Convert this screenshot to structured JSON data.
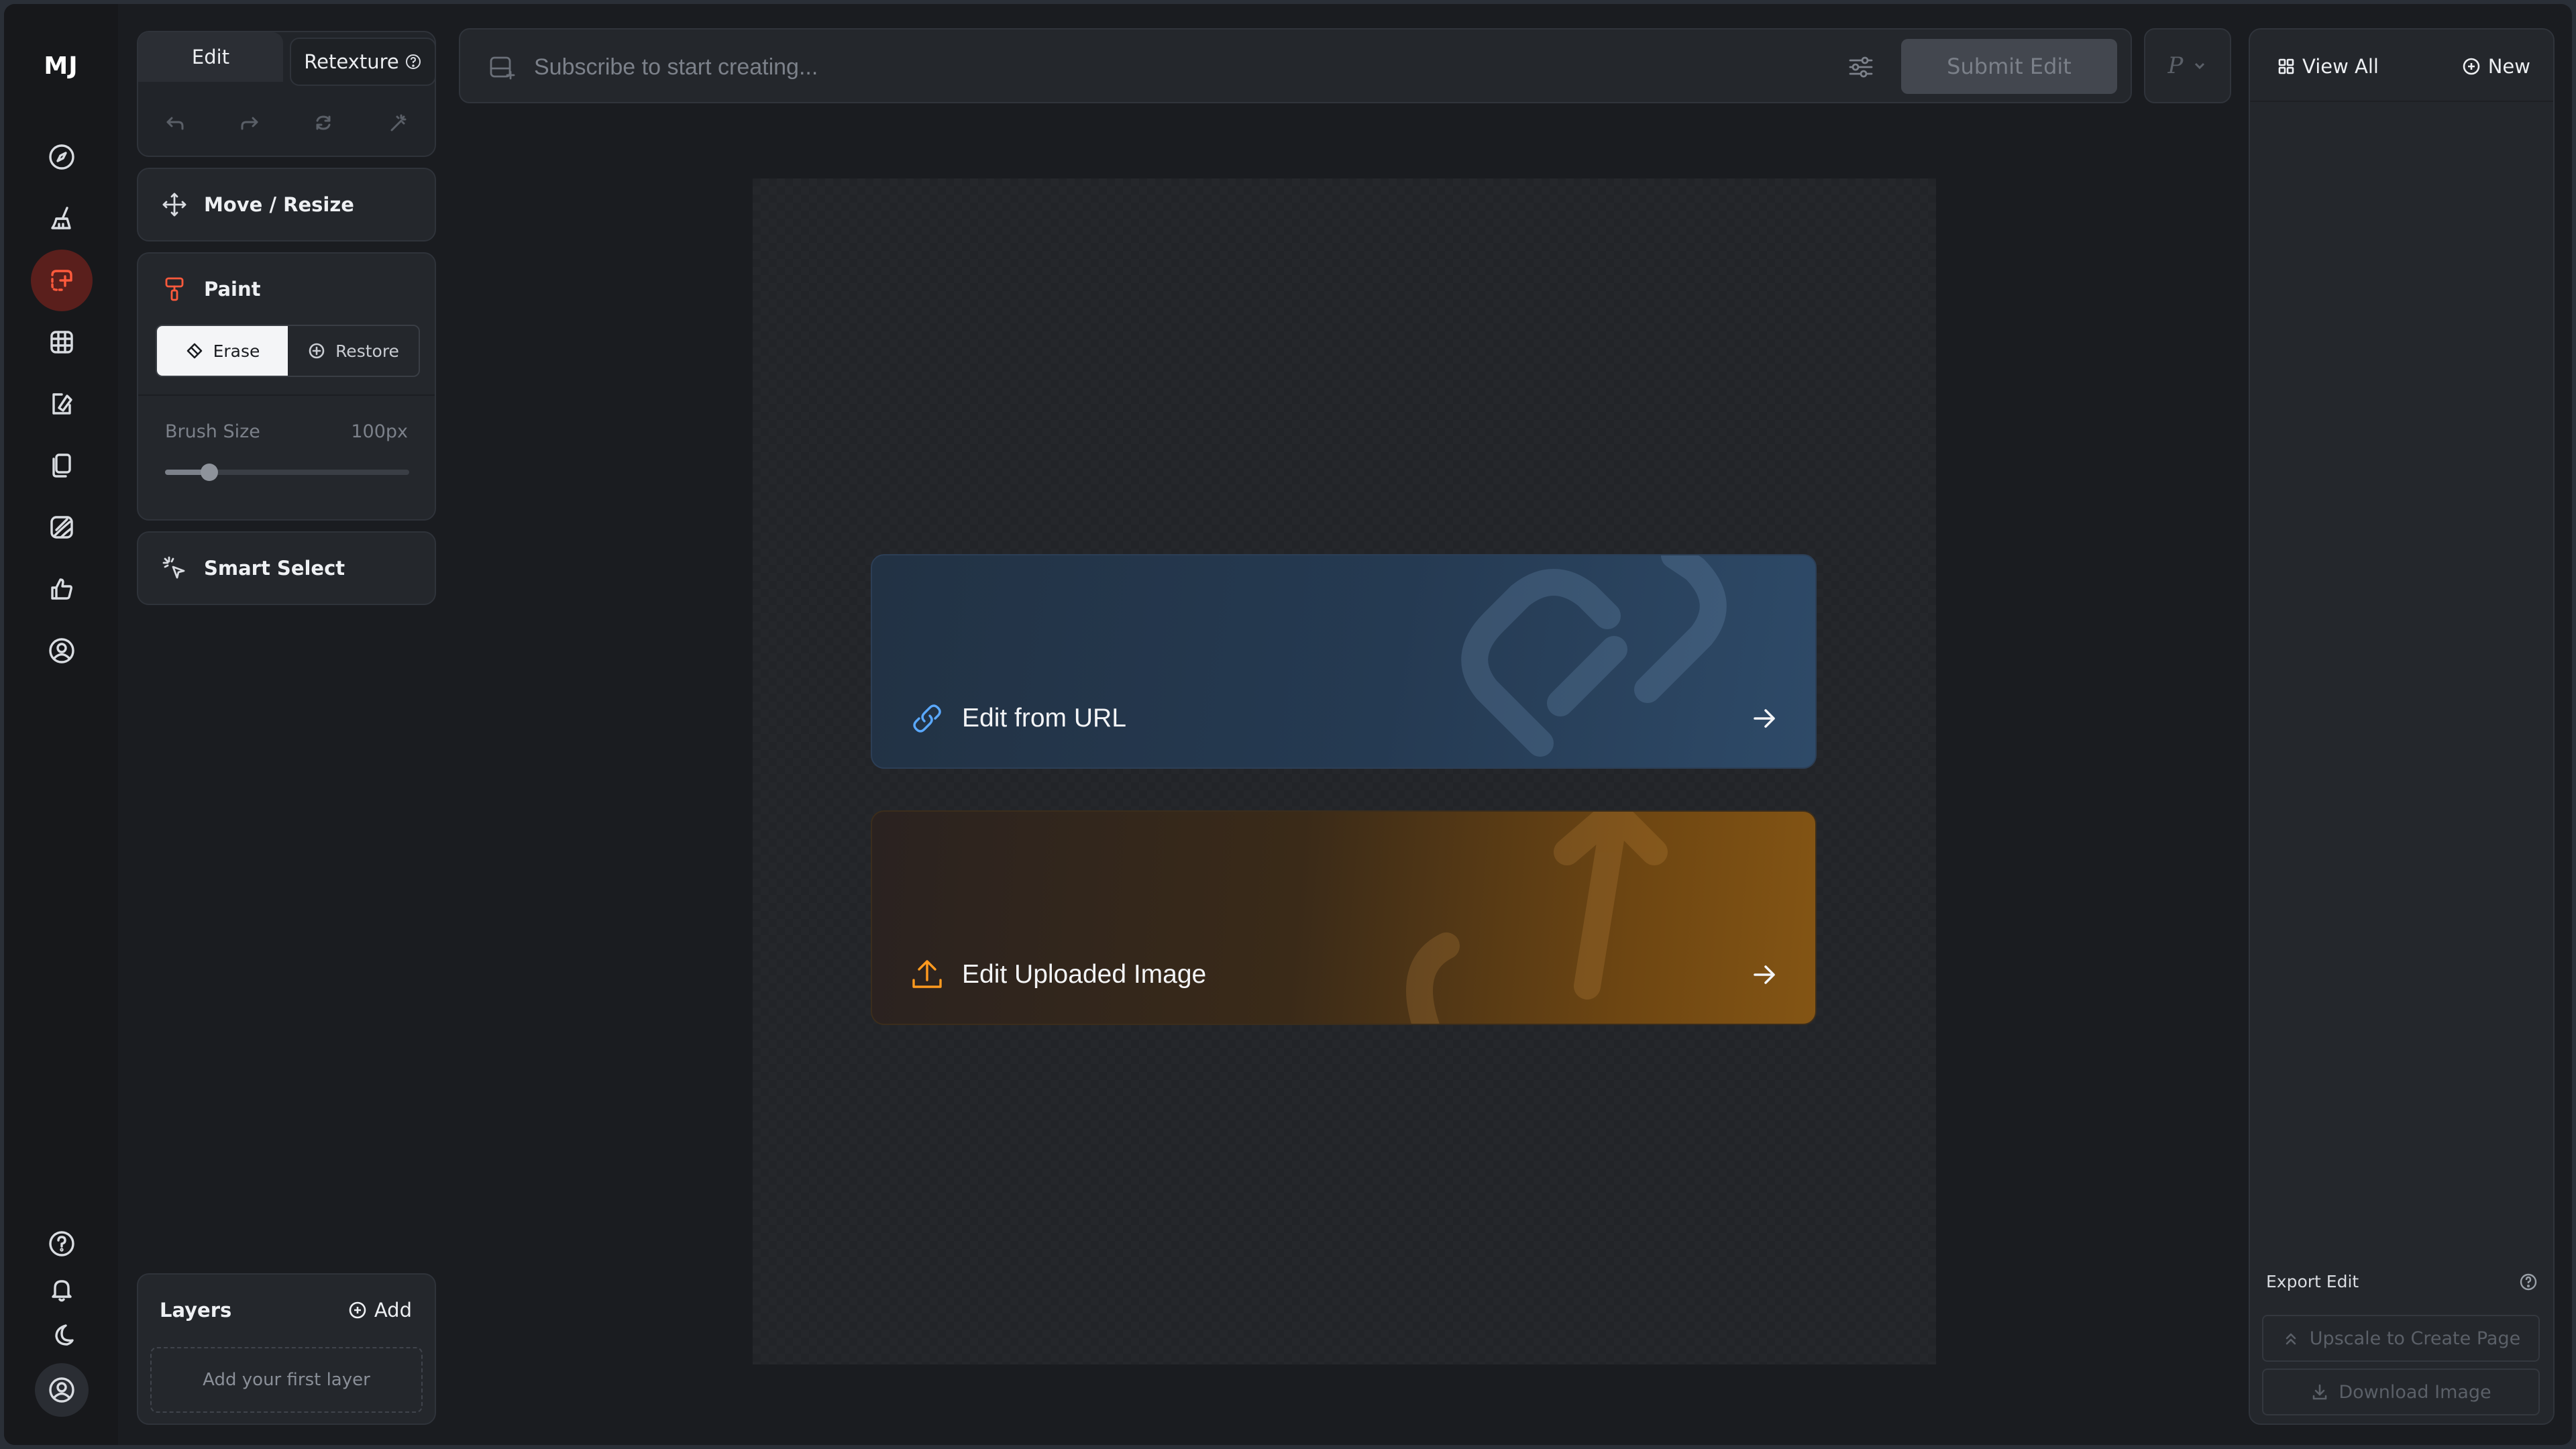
{
  "rail": {
    "logo": "MJ",
    "items": [
      {
        "name": "explore",
        "icon": "compass-icon"
      },
      {
        "name": "create",
        "icon": "paintbrush-icon"
      },
      {
        "name": "edit",
        "icon": "edit-frame-icon",
        "active": true
      },
      {
        "name": "organize",
        "icon": "grid-icon"
      },
      {
        "name": "personalize",
        "icon": "palette-icon"
      },
      {
        "name": "moodboards",
        "icon": "copy-icon"
      },
      {
        "name": "rate",
        "icon": "ratings-icon"
      },
      {
        "name": "likes",
        "icon": "thumbs-up-icon"
      },
      {
        "name": "profile",
        "icon": "user-circle-icon"
      }
    ],
    "bottom": [
      {
        "name": "help",
        "icon": "question-icon"
      },
      {
        "name": "notifications",
        "icon": "bell-icon"
      },
      {
        "name": "theme",
        "icon": "moon-icon"
      },
      {
        "name": "account",
        "icon": "user-circle-icon"
      }
    ]
  },
  "tools": {
    "tab_edit": "Edit",
    "tab_retexture": "Retexture",
    "move_resize": "Move / Resize",
    "paint": "Paint",
    "erase": "Erase",
    "restore": "Restore",
    "brush_size_label": "Brush Size",
    "brush_size_value": "100px",
    "brush_size_fraction": 0.18,
    "smart_select": "Smart Select"
  },
  "layers": {
    "title": "Layers",
    "add_label": "Add",
    "empty_text": "Add your first layer"
  },
  "prompt": {
    "placeholder": "Subscribe to start creating...",
    "submit_label": "Submit Edit",
    "param_label": "P"
  },
  "cards": {
    "url_label": "Edit from URL",
    "upload_label": "Edit Uploaded Image"
  },
  "right_panel": {
    "view_all": "View All",
    "new_label": "New",
    "export_title": "Export Edit",
    "upscale_label": "Upscale to Create Page",
    "download_label": "Download Image"
  },
  "colors": {
    "accent": "#ff5a3c",
    "url_card": "#253a52",
    "upload_card": "#845514"
  }
}
